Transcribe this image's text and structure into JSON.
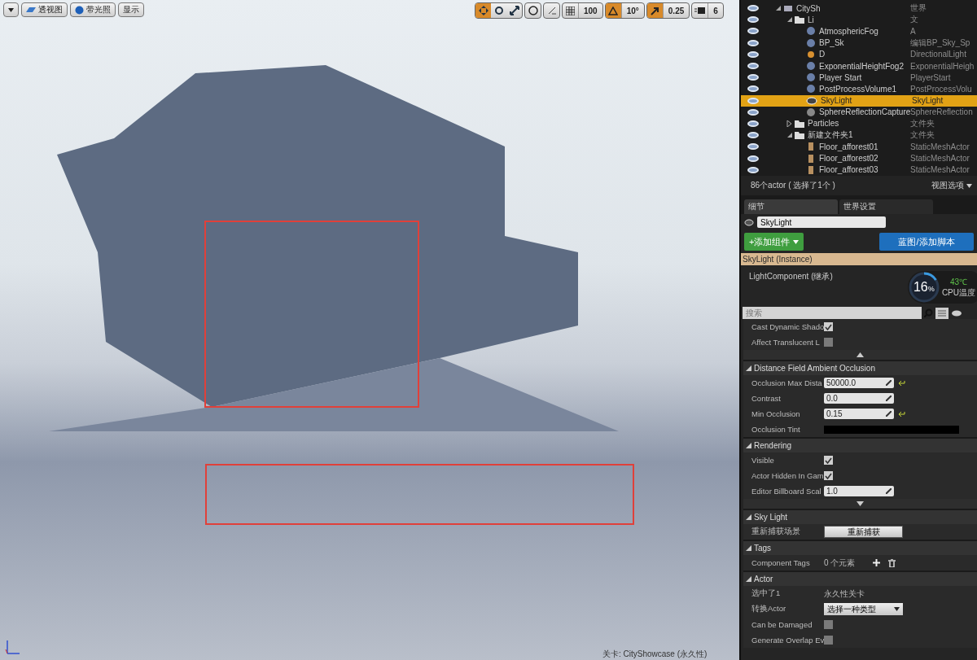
{
  "viewport": {
    "toolbar_left": [
      {
        "kind": "menu"
      },
      {
        "kind": "view",
        "label": "透视图"
      },
      {
        "kind": "lit",
        "label": "带光照"
      },
      {
        "kind": "plain",
        "label": "显示"
      }
    ],
    "transform_modes": [
      {
        "kind": "move",
        "selected": true
      },
      {
        "kind": "rotate",
        "selected": false
      },
      {
        "kind": "scale",
        "selected": false
      }
    ],
    "snaps": [
      {
        "kind": "grid",
        "value": "100",
        "selected": false
      },
      {
        "kind": "angle",
        "value": "10°",
        "selected": true
      },
      {
        "kind": "scale",
        "value": "0.25",
        "selected": true
      },
      {
        "kind": "speed",
        "value": "6",
        "selected": false
      }
    ],
    "annotations": [
      {
        "kind": "rect"
      },
      {
        "kind": "rect"
      }
    ],
    "level_label": "关卡: CityShowcase (永久性)"
  },
  "outliner": {
    "rows": [
      {
        "kind": "world",
        "name": "CitySh",
        "type": "世界",
        "selected": false,
        "expanded": true,
        "children": [
          {
            "kind": "folder",
            "name": "Li",
            "type": "文",
            "selected": false,
            "expanded": true,
            "children": [
              {
                "kind": "actor",
                "name": "AtmosphericFog",
                "type": "A",
                "selected": false
              },
              {
                "kind": "actor",
                "name": "BP_Sk",
                "type": "编辑BP_Sky_Sp",
                "selected": false
              },
              {
                "kind": "light",
                "name": "D",
                "type": "DirectionalLight",
                "selected": false
              },
              {
                "kind": "actor",
                "name": "ExponentialHeightFog2",
                "type": "ExponentialHeigh",
                "selected": false
              },
              {
                "kind": "actor",
                "name": "Player Start",
                "type": "PlayerStart",
                "selected": false
              },
              {
                "kind": "actor",
                "name": "PostProcessVolume1",
                "type": "PostProcessVolu",
                "selected": false
              },
              {
                "kind": "sky",
                "name": "SkyLight",
                "type": "SkyLight",
                "selected": true
              },
              {
                "kind": "sphere",
                "name": "SphereReflectionCapture",
                "type": "SphereReflection",
                "selected": false
              }
            ]
          },
          {
            "kind": "folder",
            "name": "Particles",
            "type": "文件夹",
            "selected": false,
            "expanded": false
          },
          {
            "kind": "folder",
            "name": "新建文件夹1",
            "type": "文件夹",
            "selected": false,
            "expanded": true,
            "children": [
              {
                "kind": "mesh",
                "name": "Floor_afforest01",
                "type": "StaticMeshActor",
                "selected": false
              },
              {
                "kind": "mesh",
                "name": "Floor_afforest02",
                "type": "StaticMeshActor",
                "selected": false
              },
              {
                "kind": "mesh",
                "name": "Floor_afforest03",
                "type": "StaticMeshActor",
                "selected": false
              }
            ]
          }
        ]
      }
    ],
    "count": "86个actor ( 选择了1个 )",
    "view_options": "视图选项"
  },
  "details": {
    "tabs": [
      {
        "label": "细节",
        "selected": true
      },
      {
        "label": "世界设置",
        "selected": false
      }
    ],
    "name_value": "SkyLight",
    "add_component": "+添加组件",
    "blueprint": "蓝图/添加脚本",
    "components": [
      {
        "label": "SkyLight (Instance)",
        "selected": true
      },
      {
        "label": "LightComponent (继承)",
        "selected": false
      }
    ],
    "search": {
      "placeholder": "搜索"
    },
    "top_rows": [
      {
        "kind": "checkbox",
        "label": "Cast Dynamic Shado",
        "checked": true
      },
      {
        "kind": "checkbox",
        "label": "Affect Translucent L",
        "checked": false
      }
    ],
    "sections": [
      {
        "title": "Distance Field Ambient Occlusion",
        "expanded": true,
        "rows": [
          {
            "kind": "number",
            "label": "Occlusion Max Dista",
            "value": "50000.0",
            "reset": true
          },
          {
            "kind": "number",
            "label": "Contrast",
            "value": "0.0"
          },
          {
            "kind": "number",
            "label": "Min Occlusion",
            "value": "0.15",
            "reset": true
          },
          {
            "kind": "color",
            "label": "Occlusion Tint",
            "color": "#000000"
          }
        ]
      },
      {
        "title": "Rendering",
        "expanded": true,
        "more": true,
        "rows": [
          {
            "kind": "checkbox",
            "label": "Visible",
            "checked": true
          },
          {
            "kind": "checkbox",
            "label": "Actor Hidden In Gam",
            "checked": true
          },
          {
            "kind": "number",
            "label": "Editor Billboard Scal",
            "value": "1.0"
          }
        ]
      },
      {
        "title": "Sky Light",
        "expanded": true,
        "rows": [
          {
            "kind": "button",
            "label": "重新捕获场景",
            "value": "重新捕获"
          }
        ]
      },
      {
        "title": "Tags",
        "expanded": true,
        "rows": [
          {
            "kind": "tags",
            "label": "Component Tags",
            "value": "0 个元素"
          }
        ]
      },
      {
        "title": "Actor",
        "expanded": true,
        "rows": [
          {
            "kind": "text",
            "label": "选中了1",
            "value": "永久性关卡"
          },
          {
            "kind": "dropdown",
            "label": "转换Actor",
            "value": "选择一种类型"
          },
          {
            "kind": "checkbox",
            "label": "Can be Damaged",
            "checked": false
          },
          {
            "kind": "checkbox",
            "label": "Generate Overlap Ev",
            "checked": false
          }
        ]
      }
    ]
  },
  "cpu_widget": {
    "percent": "16",
    "unit": "%",
    "temp": "43℃",
    "label": "CPU温度",
    "level": 0.16
  }
}
